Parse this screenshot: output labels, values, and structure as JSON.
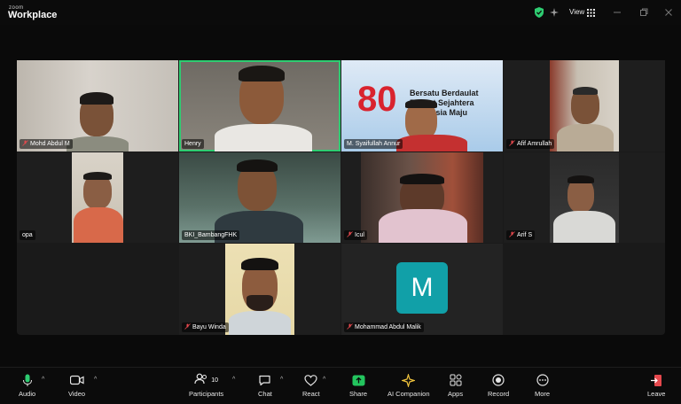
{
  "app": {
    "brand_top": "zoom",
    "brand_main": "Workplace",
    "view_label": "View"
  },
  "participants": [
    {
      "name": "Mohd Abdul M",
      "muted": true
    },
    {
      "name": "Henry",
      "muted": false,
      "speaking": true
    },
    {
      "name": "M. Syaifullah Annur",
      "muted": false
    },
    {
      "name": "Afif Amrullah",
      "muted": true
    },
    {
      "name": "opa",
      "muted": false
    },
    {
      "name": "BKI_BambangFHK",
      "muted": false
    },
    {
      "name": "Icul",
      "muted": true
    },
    {
      "name": "Arif S",
      "muted": true
    },
    {
      "name": "Bayu Winda",
      "muted": true
    },
    {
      "name": "Mohammad Abdul Malik",
      "muted": true,
      "avatar_letter": "M"
    }
  ],
  "background_banner": {
    "number": "80",
    "line1": "Bersatu Berdaulat",
    "line2": "Rakyat Sejahtera",
    "line3": "Indonesia Maju"
  },
  "toolbar": {
    "audio": "Audio",
    "video": "Video",
    "participants": "Participants",
    "participants_count": "10",
    "chat": "Chat",
    "react": "React",
    "share": "Share",
    "ai_companion": "AI Companion",
    "apps": "Apps",
    "record": "Record",
    "more": "More",
    "leave": "Leave"
  },
  "colors": {
    "accent_green": "#2ecc71",
    "mute_red": "#e5484d",
    "avatar_teal": "#11a0a8",
    "share_green": "#23c55e"
  }
}
